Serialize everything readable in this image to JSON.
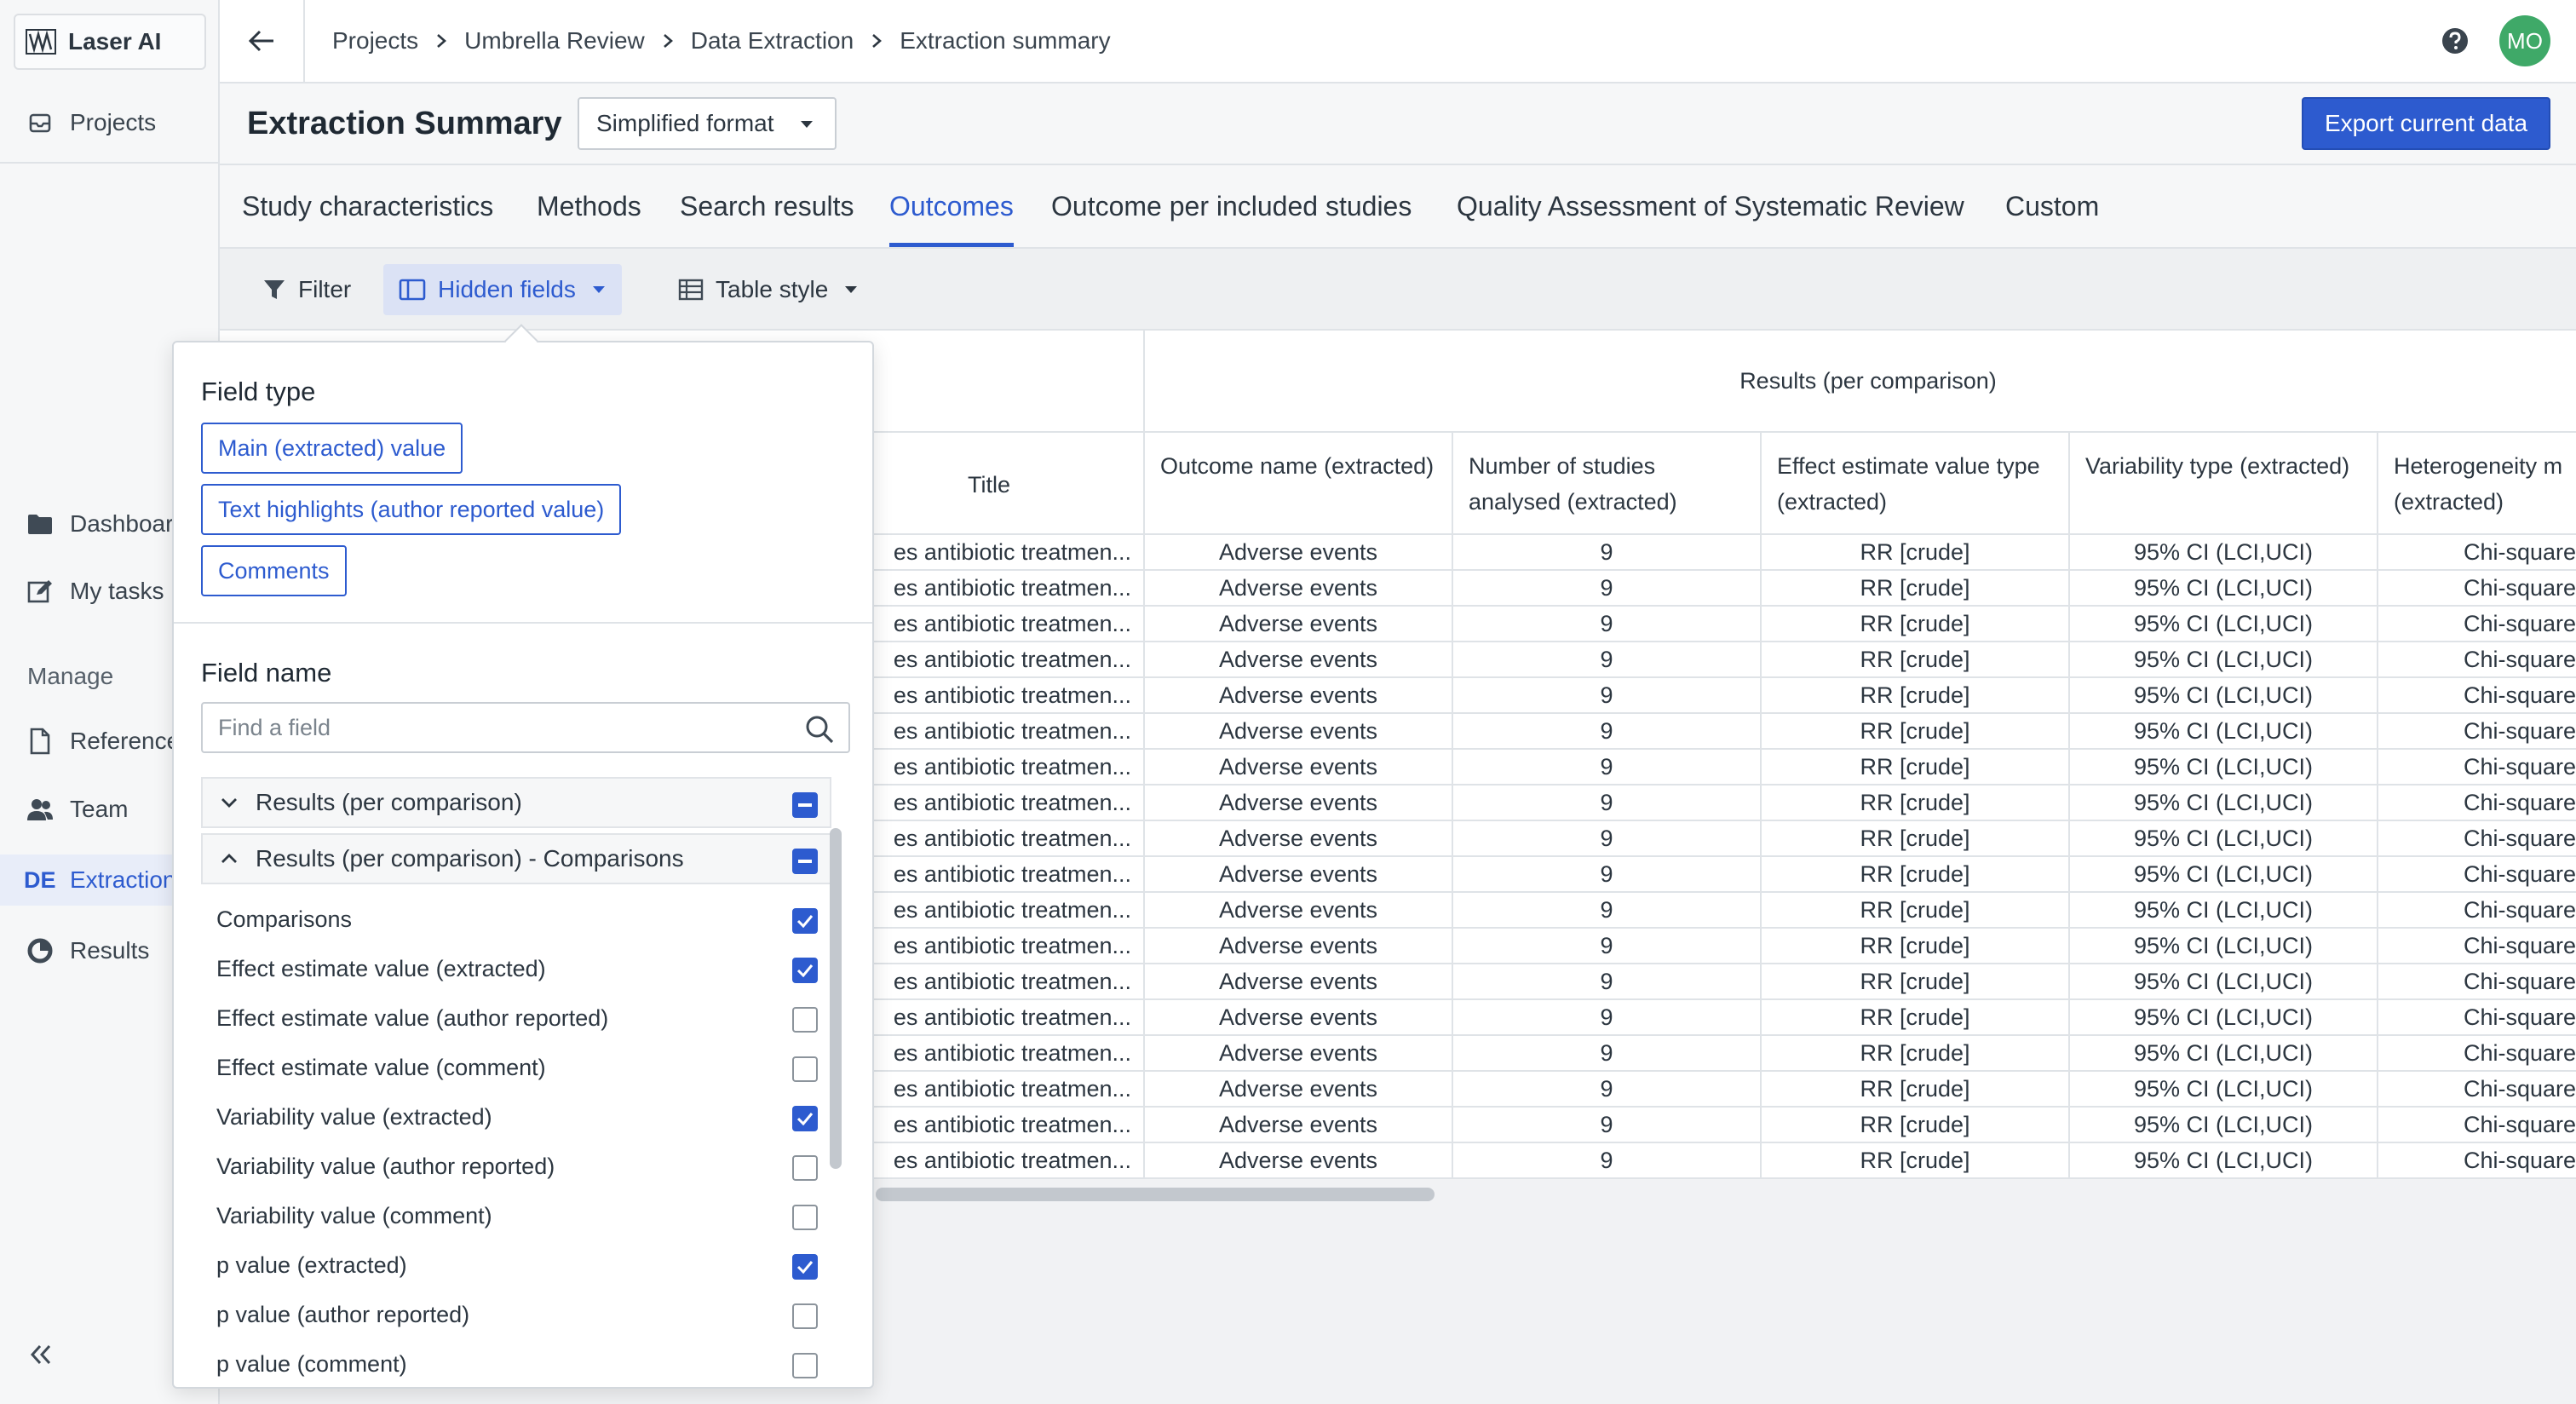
{
  "app": {
    "name": "Laser AI"
  },
  "sidebar": {
    "projects_label": "Projects",
    "items": [
      {
        "label": "Dashboard",
        "icon": "folder-icon"
      },
      {
        "label": "My tasks",
        "icon": "edit-icon"
      }
    ],
    "manage_heading": "Manage",
    "manage_items": [
      {
        "label": "References",
        "icon": "document-icon"
      },
      {
        "label": "Team",
        "icon": "team-icon"
      },
      {
        "badge": "DE",
        "label": "Extraction",
        "active": true
      },
      {
        "label": "Results",
        "icon": "pie-chart-icon"
      }
    ]
  },
  "breadcrumb": [
    "Projects",
    "Umbrella Review",
    "Data Extraction",
    "Extraction summary"
  ],
  "user": {
    "initials": "MO",
    "avatar_color": "#3fa968"
  },
  "header": {
    "title": "Extraction Summary",
    "format_value": "Simplified format",
    "export_label": "Export current data"
  },
  "tabs": [
    "Study characteristics",
    "Methods",
    "Search results",
    "Outcomes",
    "Outcome per included studies",
    "Quality Assessment of Systematic Review",
    "Custom"
  ],
  "active_tab": "Outcomes",
  "toolbar": {
    "filter_label": "Filter",
    "hidden_fields_label": "Hidden fields",
    "table_style_label": "Table style"
  },
  "table": {
    "group_header": "Results (per comparison)",
    "columns": [
      "Title",
      "Outcome name (extracted)",
      "Number of studies analysed (extracted)",
      "Effect estimate value type (extracted)",
      "Variability type (extracted)",
      "Heterogeneity m (extracted)"
    ],
    "row_template": {
      "title": "es antibiotic treatmen...",
      "outcome": "Adverse events",
      "n_studies": "9",
      "effect_type": "RR [crude]",
      "variability": "95% CI (LCI,UCI)",
      "heterogeneity": "Chi-square"
    },
    "row_count": 18
  },
  "hidden_fields": {
    "field_type_heading": "Field type",
    "field_types": [
      "Main (extracted) value",
      "Text highlights (author reported value)",
      "Comments"
    ],
    "field_name_heading": "Field name",
    "search_placeholder": "Find a field",
    "groups": [
      {
        "label": "Results (per comparison)",
        "expanded": false,
        "state": "mixed"
      },
      {
        "label": "Results (per comparison) - Comparisons",
        "expanded": true,
        "state": "mixed"
      }
    ],
    "fields": [
      {
        "label": "Comparisons",
        "checked": true
      },
      {
        "label": "Effect estimate value (extracted)",
        "checked": true
      },
      {
        "label": "Effect estimate value (author reported)",
        "checked": false
      },
      {
        "label": "Effect estimate value (comment)",
        "checked": false
      },
      {
        "label": "Variability value (extracted)",
        "checked": true
      },
      {
        "label": "Variability value (author reported)",
        "checked": false
      },
      {
        "label": "Variability value (comment)",
        "checked": false
      },
      {
        "label": "p value (extracted)",
        "checked": true
      },
      {
        "label": "p value (author reported)",
        "checked": false
      },
      {
        "label": "p value (comment)",
        "checked": false
      }
    ]
  },
  "colors": {
    "accent": "#2d5bcf",
    "border": "#dfe3e7",
    "sidebar_bg": "#f6f7f8"
  }
}
